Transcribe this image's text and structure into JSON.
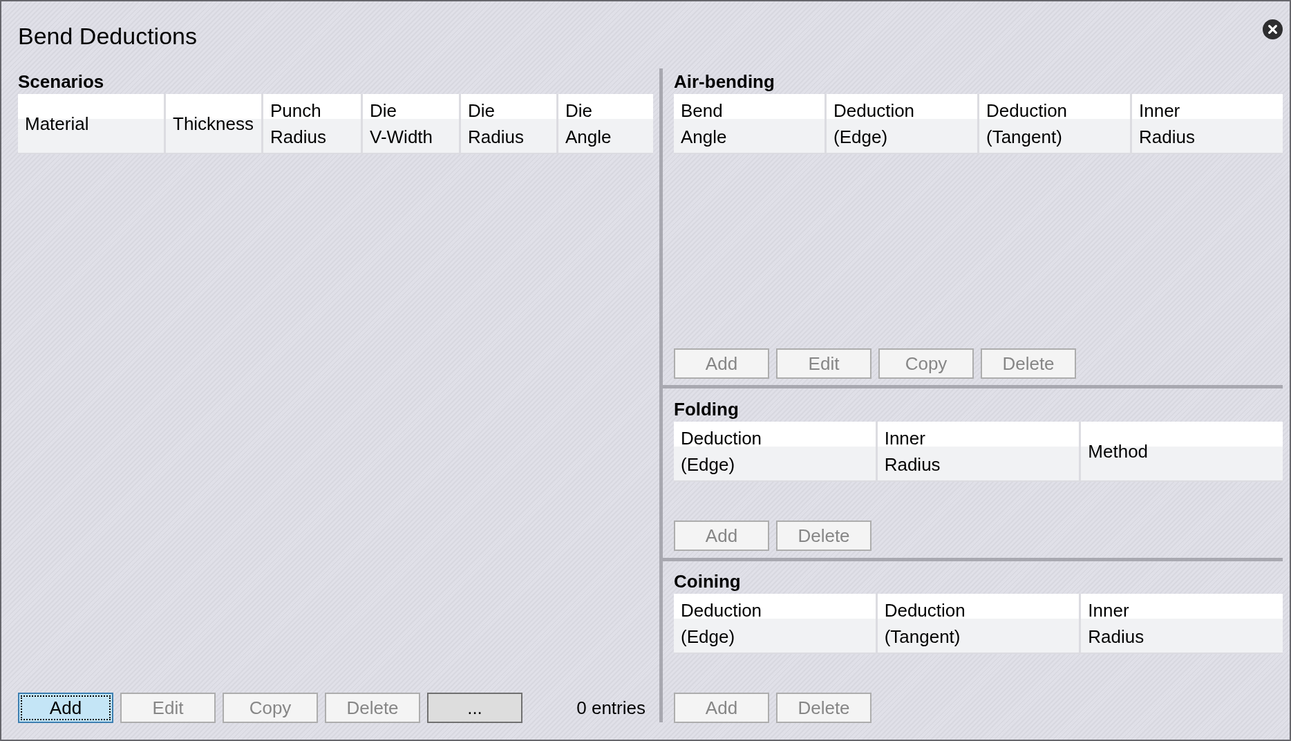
{
  "window": {
    "title": "Bend Deductions"
  },
  "scenarios": {
    "title": "Scenarios",
    "columns": [
      "Material",
      "Thickness",
      "Punch\nRadius",
      "Die\nV-Width",
      "Die\nRadius",
      "Die\nAngle"
    ],
    "buttons": [
      {
        "label": "Add",
        "disabled": false,
        "focused": true
      },
      {
        "label": "Edit",
        "disabled": true,
        "focused": false
      },
      {
        "label": "Copy",
        "disabled": true,
        "focused": false
      },
      {
        "label": "Delete",
        "disabled": true,
        "focused": false
      },
      {
        "label": "...",
        "disabled": false,
        "focused": false
      }
    ],
    "entry_count": "0 entries"
  },
  "deduction_tables": [
    {
      "title": "Air-bending",
      "columns": [
        "Bend\nAngle",
        "Deduction\n(Edge)",
        "Deduction\n(Tangent)",
        "Inner\nRadius"
      ],
      "buttons": [
        {
          "label": "Add",
          "disabled": true,
          "focused": false
        },
        {
          "label": "Edit",
          "disabled": true,
          "focused": false
        },
        {
          "label": "Copy",
          "disabled": true,
          "focused": false
        },
        {
          "label": "Delete",
          "disabled": true,
          "focused": false
        }
      ]
    },
    {
      "title": "Folding",
      "columns": [
        "Deduction\n(Edge)",
        "Inner\nRadius",
        "Method"
      ],
      "buttons": [
        {
          "label": "Add",
          "disabled": true,
          "focused": false
        },
        {
          "label": "Delete",
          "disabled": true,
          "focused": false
        }
      ]
    },
    {
      "title": "Coining",
      "columns": [
        "Deduction\n(Edge)",
        "Deduction\n(Tangent)",
        "Inner\nRadius"
      ],
      "buttons": [
        {
          "label": "Add",
          "disabled": true,
          "focused": false
        },
        {
          "label": "Delete",
          "disabled": true,
          "focused": false
        }
      ]
    }
  ]
}
